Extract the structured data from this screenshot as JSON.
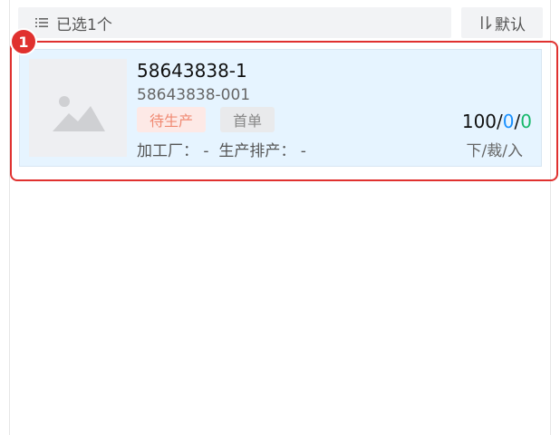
{
  "toolbar": {
    "selected_label": "已选1个",
    "sort_label": "默认",
    "selected_icon": "list-icon",
    "sort_icon": "sort-order-icon"
  },
  "highlight": {
    "badge_number": "1",
    "color": "#e0312f"
  },
  "order_card": {
    "image_icon": "image-placeholder-icon",
    "title": "58643838-1",
    "sub_code": "58643838-001",
    "status_tag": "待生产",
    "first_tag": "首单",
    "factory_label": "加工厂：",
    "factory_value": "-",
    "schedule_label": "生产排产：",
    "schedule_value": "-",
    "count_total": "100",
    "count_cut": "0",
    "count_in": "0",
    "count_sep": "/",
    "counts_caption": "下/裁/入",
    "background": "#e6f4ff"
  }
}
